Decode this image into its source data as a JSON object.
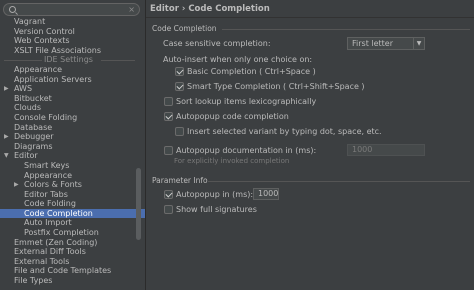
{
  "search": {
    "value": "",
    "clear_icon": "×"
  },
  "sidebar": {
    "items": [
      {
        "label": "Vagrant"
      },
      {
        "label": "Version Control"
      },
      {
        "label": "Web Contexts"
      },
      {
        "label": "XSLT File Associations"
      },
      {
        "label": "IDE Settings",
        "group": true
      },
      {
        "label": "Appearance"
      },
      {
        "label": "Application Servers"
      },
      {
        "label": "AWS",
        "arrow": "▶"
      },
      {
        "label": "Bitbucket"
      },
      {
        "label": "Clouds"
      },
      {
        "label": "Console Folding"
      },
      {
        "label": "Database"
      },
      {
        "label": "Debugger",
        "arrow": "▶"
      },
      {
        "label": "Diagrams"
      },
      {
        "label": "Editor",
        "arrow": "▼"
      },
      {
        "label": "Smart Keys",
        "sub": true
      },
      {
        "label": "Appearance",
        "sub": true
      },
      {
        "label": "Colors & Fonts",
        "sub": true,
        "arrow": "▶"
      },
      {
        "label": "Editor Tabs",
        "sub": true
      },
      {
        "label": "Code Folding",
        "sub": true
      },
      {
        "label": "Code Completion",
        "sub": true,
        "selected": true
      },
      {
        "label": "Auto Import",
        "sub": true
      },
      {
        "label": "Postfix Completion",
        "sub": true
      },
      {
        "label": "Emmet (Zen Coding)"
      },
      {
        "label": "External Diff Tools"
      },
      {
        "label": "External Tools"
      },
      {
        "label": "File and Code Templates"
      },
      {
        "label": "File Types"
      }
    ]
  },
  "header": {
    "title": "Editor › Code Completion"
  },
  "code_completion": {
    "section_title": "Code Completion",
    "case_sensitive_label": "Case sensitive completion:",
    "case_sensitive_value": "First letter",
    "autoinsert_label": "Auto-insert when only one choice on:",
    "basic_completion": {
      "label": "Basic Completion ( Ctrl+Space )",
      "checked": true
    },
    "smart_type_completion": {
      "label": "Smart Type Completion ( Ctrl+Shift+Space )",
      "checked": true
    },
    "sort_lexicographically": {
      "label": "Sort lookup items lexicographically",
      "checked": false
    },
    "autopopup_code_completion": {
      "label": "Autopopup code completion",
      "checked": true
    },
    "insert_selected_variant": {
      "label": "Insert selected variant by typing dot, space, etc.",
      "checked": false
    },
    "autopopup_documentation": {
      "label": "Autopopup documentation in (ms):",
      "checked": false,
      "value": "1000"
    },
    "explicit_hint": "For explicitly invoked completion"
  },
  "parameter_info": {
    "section_title": "Parameter Info",
    "autopopup": {
      "label": "Autopopup in (ms):",
      "checked": true,
      "value": "1000"
    },
    "show_full_signatures": {
      "label": "Show full signatures",
      "checked": false
    }
  },
  "colors": {
    "background": "#3c3f41",
    "selection": "#4b6eaf",
    "text": "#bbbbbb"
  }
}
